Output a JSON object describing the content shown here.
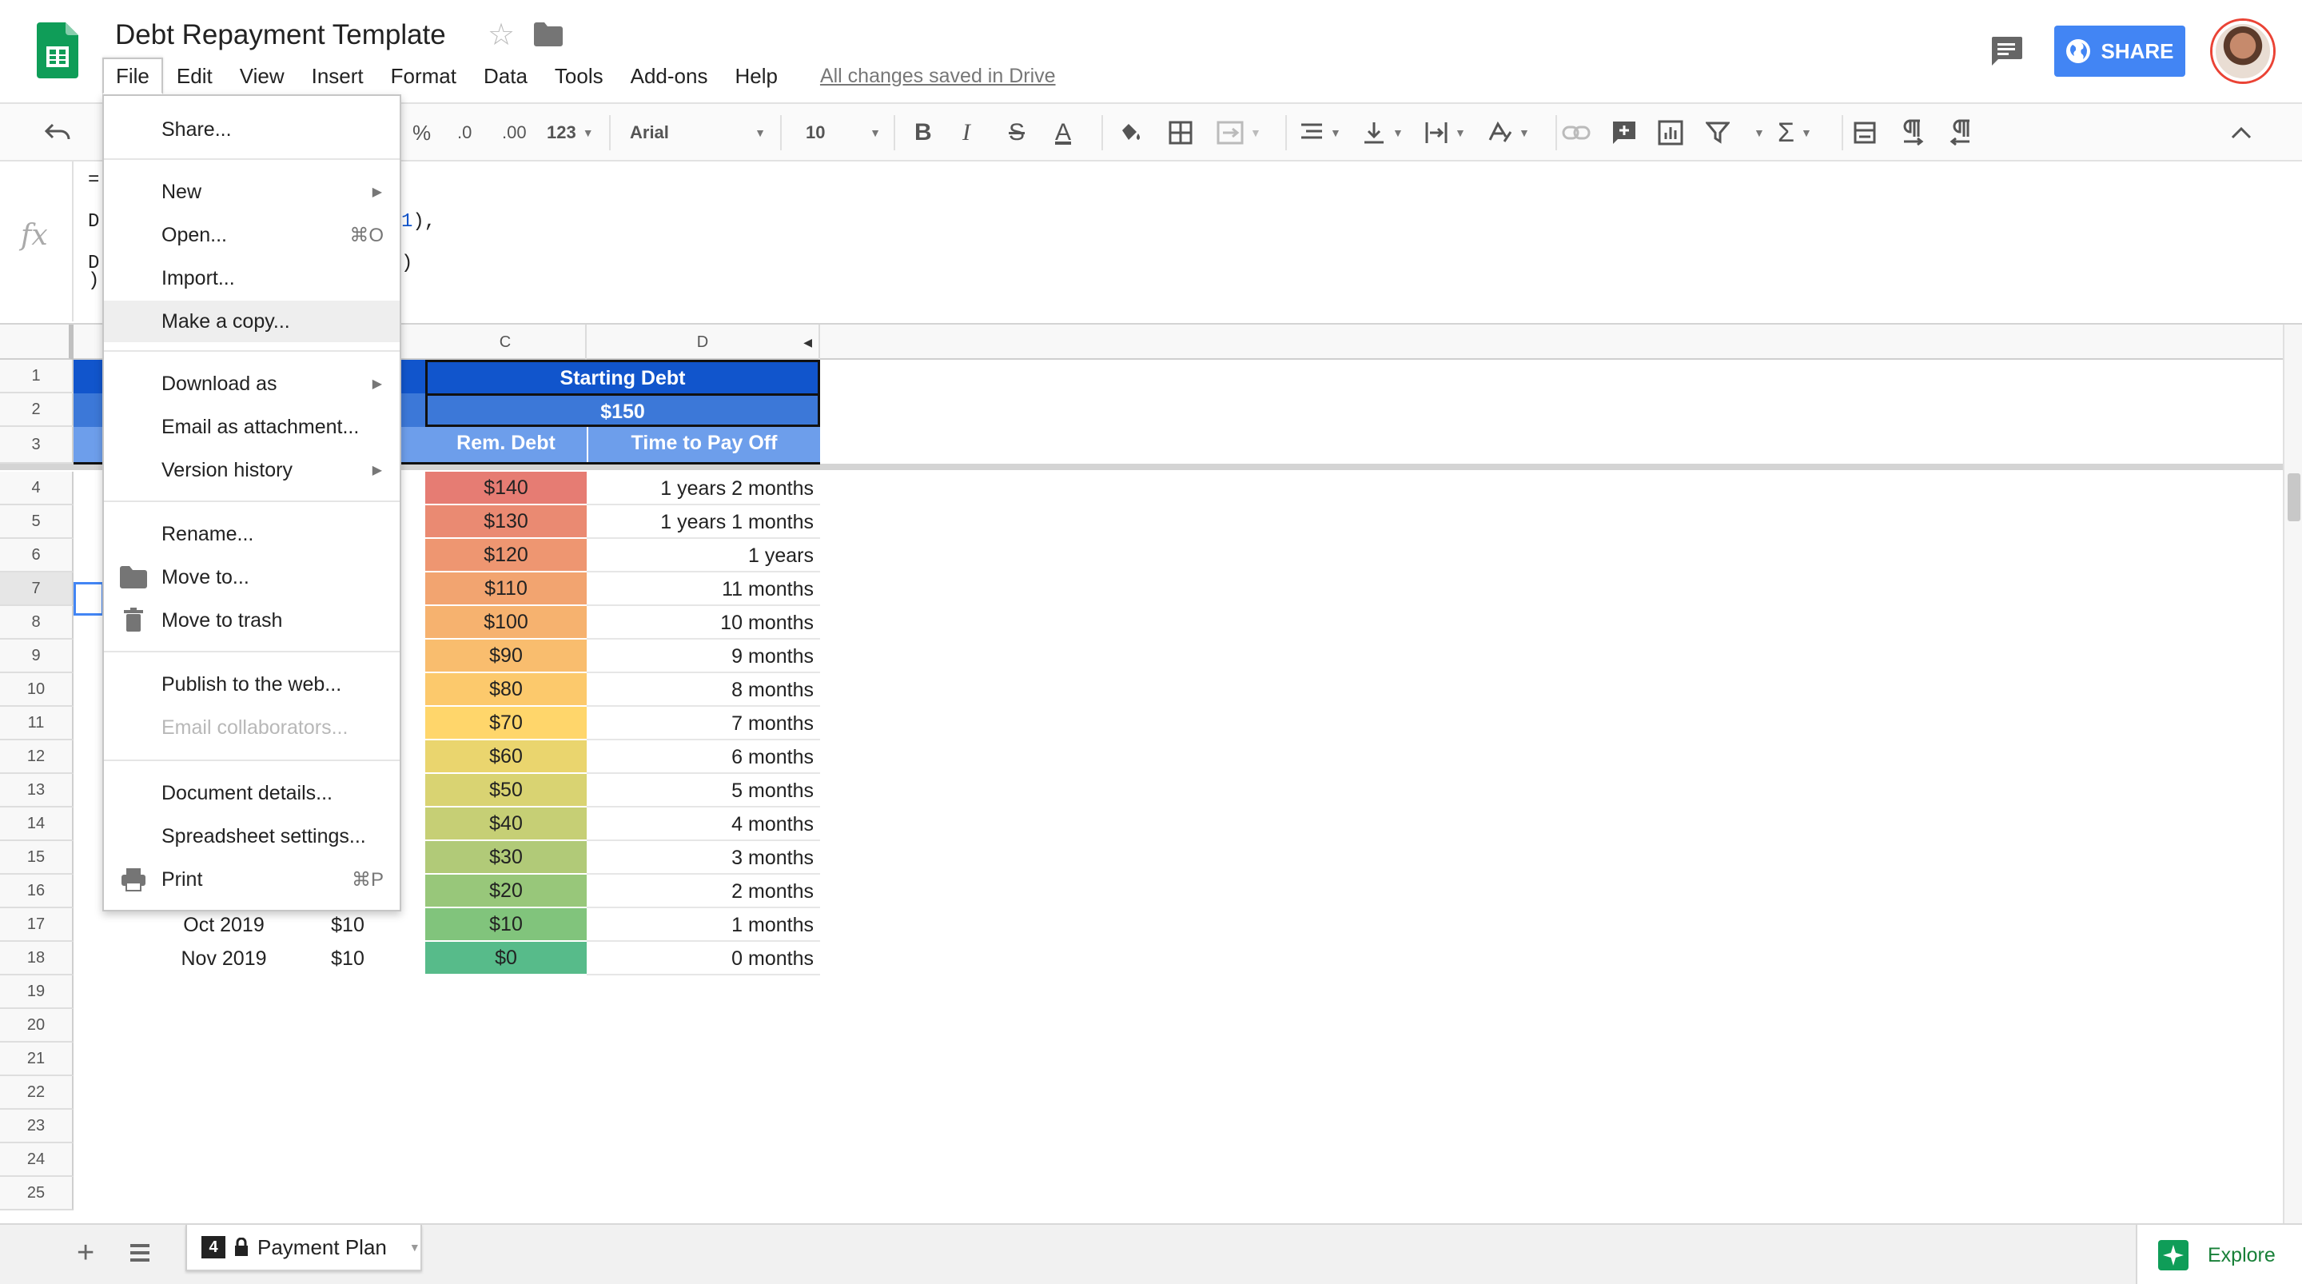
{
  "header": {
    "doc_title": "Debt Repayment Template",
    "save_status": "All changes saved in Drive",
    "share_label": "SHARE"
  },
  "menubar": [
    "File",
    "Edit",
    "View",
    "Insert",
    "Format",
    "Data",
    "Tools",
    "Add-ons",
    "Help"
  ],
  "toolbar": {
    "percent": "%",
    "dec_decrease": ".0",
    "dec_increase": ".00",
    "more_formats": "123",
    "font": "Arial",
    "font_size": "10",
    "bold": "B",
    "italic": "I",
    "strikethrough": "S",
    "text_color": "A"
  },
  "formula": {
    "line1": "=",
    "line2_prefix": "D",
    "line2_ref": "1",
    "line2_suffix": "),",
    "line3_prefix": "D",
    "line3_suffix": ")",
    "line4": ")"
  },
  "file_menu": {
    "share": "Share...",
    "new": "New",
    "open": "Open...",
    "open_shortcut": "⌘O",
    "import": "Import...",
    "make_copy": "Make a copy...",
    "download_as": "Download as",
    "email_attachment": "Email as attachment...",
    "version_history": "Version history",
    "rename": "Rename...",
    "move_to": "Move to...",
    "move_to_trash": "Move to trash",
    "publish": "Publish to the web...",
    "email_collaborators": "Email collaborators...",
    "document_details": "Document details...",
    "spreadsheet_settings": "Spreadsheet settings...",
    "print": "Print",
    "print_shortcut": "⌘P"
  },
  "sheet": {
    "columns": [
      "C",
      "D"
    ],
    "rows": [
      "1",
      "2",
      "3",
      "4",
      "5",
      "6",
      "7",
      "8",
      "9",
      "10",
      "11",
      "12",
      "13",
      "14",
      "15",
      "16",
      "17",
      "18",
      "19",
      "20",
      "21",
      "22",
      "23",
      "24",
      "25"
    ],
    "header_starting_debt": "Starting Debt",
    "header_amount": "$150",
    "col_rem_debt": "Rem. Debt",
    "col_time": "Time to Pay Off",
    "data_rows": [
      {
        "rem": "$140",
        "time": "1 years 2 months",
        "color": "#e67c73"
      },
      {
        "rem": "$130",
        "time": "1 years 1 months",
        "color": "#ea8a72"
      },
      {
        "rem": "$120",
        "time": "1 years",
        "color": "#ee9671"
      },
      {
        "rem": "$110",
        "time": "11 months",
        "color": "#f2a470"
      },
      {
        "rem": "$100",
        "time": "10 months",
        "color": "#f6b26f"
      },
      {
        "rem": "$90",
        "time": "9 months",
        "color": "#f9bd6e"
      },
      {
        "rem": "$80",
        "time": "8 months",
        "color": "#fcc96c"
      },
      {
        "rem": "$70",
        "time": "7 months",
        "color": "#ffd66b"
      },
      {
        "rem": "$60",
        "time": "6 months",
        "color": "#ead56e"
      },
      {
        "rem": "$50",
        "time": "5 months",
        "color": "#d9d372"
      },
      {
        "rem": "$40",
        "time": "4 months",
        "color": "#c6cf75"
      },
      {
        "rem": "$30",
        "time": "3 months",
        "color": "#b1ca78"
      },
      {
        "rem": "$20",
        "time": "2 months",
        "color": "#98c77a"
      },
      {
        "rem": "$10",
        "time": "1 months",
        "color": "#81c47c",
        "date": "Oct 2019",
        "payment": "$10"
      },
      {
        "rem": "$0",
        "time": "0 months",
        "color": "#57bb8a",
        "date": "Nov 2019",
        "payment": "$10"
      }
    ]
  },
  "sheet_tab": {
    "badge": "4",
    "name": "Payment Plan"
  },
  "explore_label": "Explore",
  "colors": {
    "header_dark_blue": "#1155cc",
    "header_light_blue": "#6d9eeb",
    "share_blue": "#4285f4",
    "sheets_green": "#0f9d58"
  }
}
